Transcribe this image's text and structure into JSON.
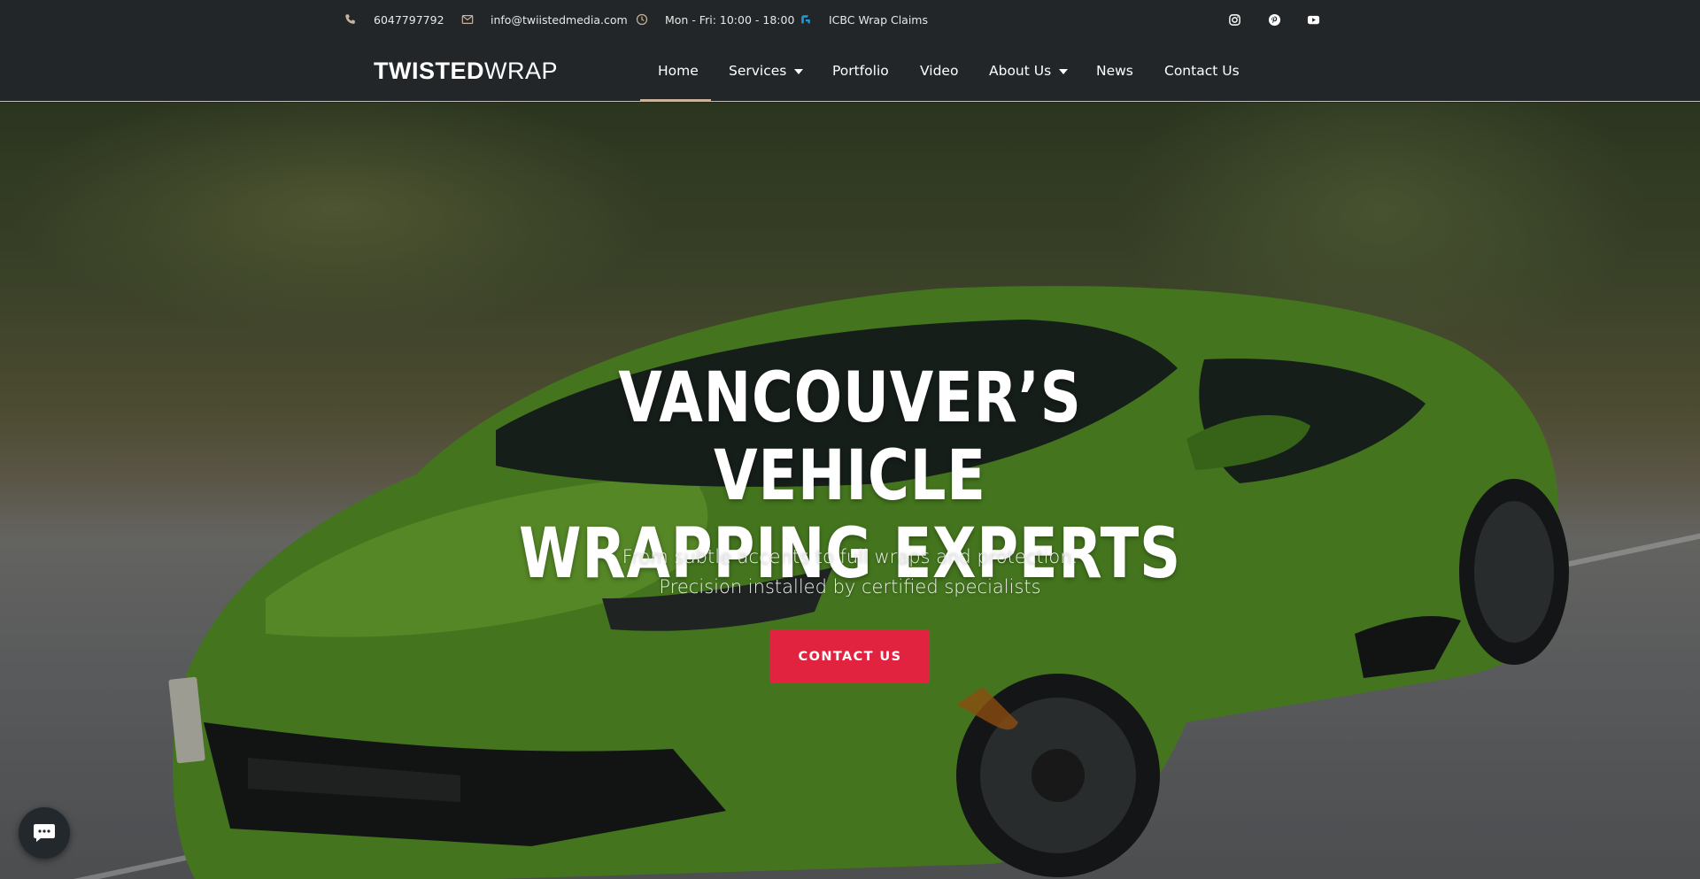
{
  "topbar": {
    "phone": "6047797792",
    "email": "info@twiistedmedia.com",
    "hours": "Mon - Fri: 10:00 - 18:00",
    "icbc": "ICBC Wrap Claims",
    "icons": [
      "phone-icon",
      "envelope-icon",
      "clock-icon",
      "icbc-icon",
      "instagram-icon",
      "pinterest-icon",
      "youtube-icon"
    ]
  },
  "logo": {
    "bold": "TWISTED",
    "light": "WRAP"
  },
  "nav": {
    "items": [
      {
        "label": "Home",
        "active": true
      },
      {
        "label": "Services",
        "dropdown": true
      },
      {
        "label": "Portfolio"
      },
      {
        "label": "Video"
      },
      {
        "label": "About Us",
        "dropdown": true
      },
      {
        "label": "News"
      },
      {
        "label": "Contact Us"
      }
    ]
  },
  "hero": {
    "title_line1": "VANCOUVER’S VEHICLE",
    "title_line2": "WRAPPING EXPERTS",
    "sub_line1": "From subtle accents to full wraps and protection.",
    "sub_line2": "Precision installed by certified specialists",
    "cta_label": "CONTACT US"
  },
  "chat": {
    "icon": "chat-icon"
  },
  "colors": {
    "background": "#222629",
    "accent_red": "#e1233f",
    "active_underline": "#c8b49a",
    "car_green": "#6fb52c",
    "icbc_blue": "#1e9ad6"
  }
}
